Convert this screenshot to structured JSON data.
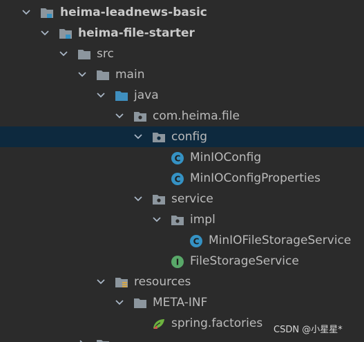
{
  "tree": {
    "items": [
      {
        "label": "heima-leadnews-basic",
        "icon": "module-folder-icon",
        "expanded": true
      },
      {
        "label": "heima-file-starter",
        "icon": "module-folder-icon",
        "expanded": true
      },
      {
        "label": "src",
        "icon": "folder-icon",
        "expanded": true
      },
      {
        "label": "main",
        "icon": "folder-icon",
        "expanded": true
      },
      {
        "label": "java",
        "icon": "source-folder-icon",
        "expanded": true
      },
      {
        "label": "com.heima.file",
        "icon": "package-icon",
        "expanded": true
      },
      {
        "label": "config",
        "icon": "package-icon",
        "expanded": true,
        "selected": true
      },
      {
        "label": "MinIOConfig",
        "icon": "class-icon"
      },
      {
        "label": "MinIOConfigProperties",
        "icon": "class-icon"
      },
      {
        "label": "service",
        "icon": "package-icon",
        "expanded": true
      },
      {
        "label": "impl",
        "icon": "package-icon",
        "expanded": true
      },
      {
        "label": "MinIOFileStorageService",
        "icon": "class-icon"
      },
      {
        "label": "FileStorageService",
        "icon": "interface-icon"
      },
      {
        "label": "resources",
        "icon": "resources-folder-icon",
        "expanded": true
      },
      {
        "label": "META-INF",
        "icon": "folder-icon",
        "expanded": true
      },
      {
        "label": "spring.factories",
        "icon": "spring-icon"
      }
    ]
  },
  "watermark": "CSDN @小星星*",
  "colors": {
    "background": "#2b2b2b",
    "selection": "#0d293e",
    "text": "#bbbbbb",
    "folder": "#8c969e",
    "source_folder": "#3f8fbf",
    "class_icon": "#3592c4",
    "interface_icon": "#59a869"
  }
}
